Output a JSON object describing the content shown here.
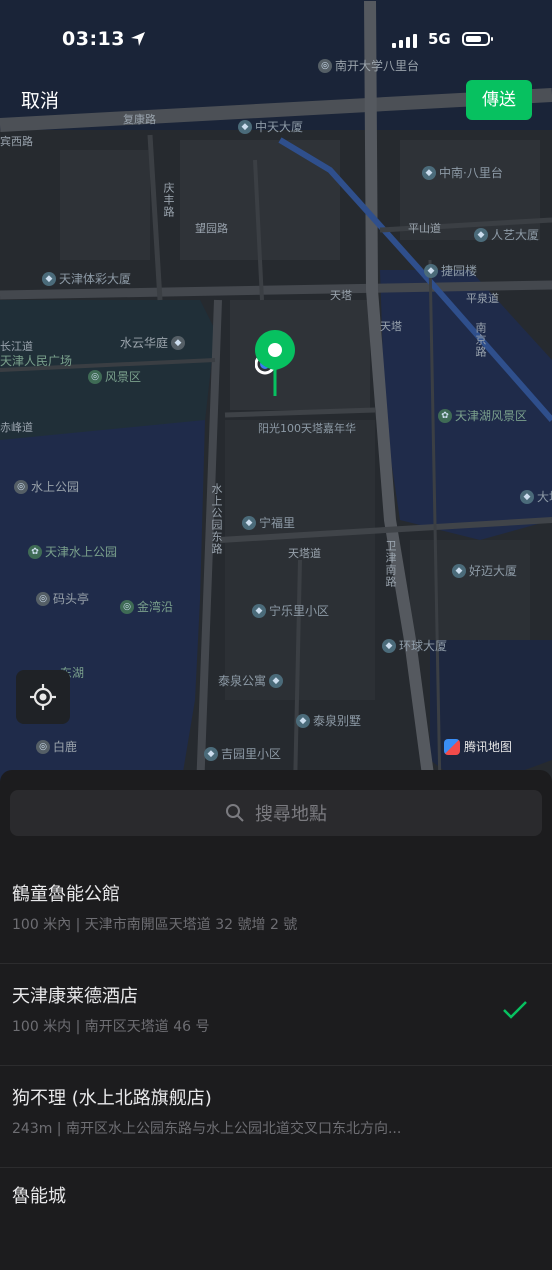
{
  "status_bar": {
    "time": "03:13",
    "network": "5G"
  },
  "nav": {
    "cancel_label": "取消",
    "send_label": "傳送"
  },
  "map": {
    "road_labels": [
      "复康路",
      "庆丰路",
      "望园路",
      "天塔",
      "天塔",
      "水上公园东路",
      "卫津南路",
      "平山道",
      "平泉道",
      "南京路",
      "宾西路",
      "天塔道",
      "长江道",
      "赤峰道"
    ],
    "pois": [
      "南开大学八里台",
      "中天大厦",
      "中南·八里台",
      "天津体彩大厦",
      "人艺大厦",
      "捷园楼",
      "水云华庭",
      "阳光100天塔嘉年华",
      "天津湖风景区",
      "水上公园",
      "宁福里",
      "金湾沿",
      "天津水上公园",
      "码头亭",
      "好迈大厦",
      "宁乐里小区",
      "泰泉公寓",
      "泰泉别墅",
      "吉园里小区",
      "环球大厦",
      "白鹿",
      "天津人民广场",
      "风景区",
      "东湖",
      "大塘里"
    ],
    "brand": "腾讯地图"
  },
  "search": {
    "placeholder": "搜尋地點"
  },
  "results": [
    {
      "name": "鶴童魯能公館",
      "address": "100 米內 | 天津市南開區天塔道 32 號增 2 號",
      "selected": false
    },
    {
      "name": "天津康莱德酒店",
      "address": "100 米内 | 南开区天塔道 46 号",
      "selected": true
    },
    {
      "name": "狗不理 (水上北路旗舰店)",
      "address": "243m | 南开区水上公园东路与水上公园北道交叉口东北方向...",
      "selected": false
    },
    {
      "name": "魯能城",
      "address": "",
      "selected": false
    }
  ],
  "colors": {
    "accent": "#07c160",
    "map_bg": "#262a2f",
    "water": "#1f2b4a",
    "road": "#4a4d52"
  },
  "icons": {
    "location_arrow": "location-arrow-icon",
    "locate": "crosshair-icon",
    "search": "search-icon",
    "check": "check-icon",
    "pin": "map-pin-icon"
  }
}
